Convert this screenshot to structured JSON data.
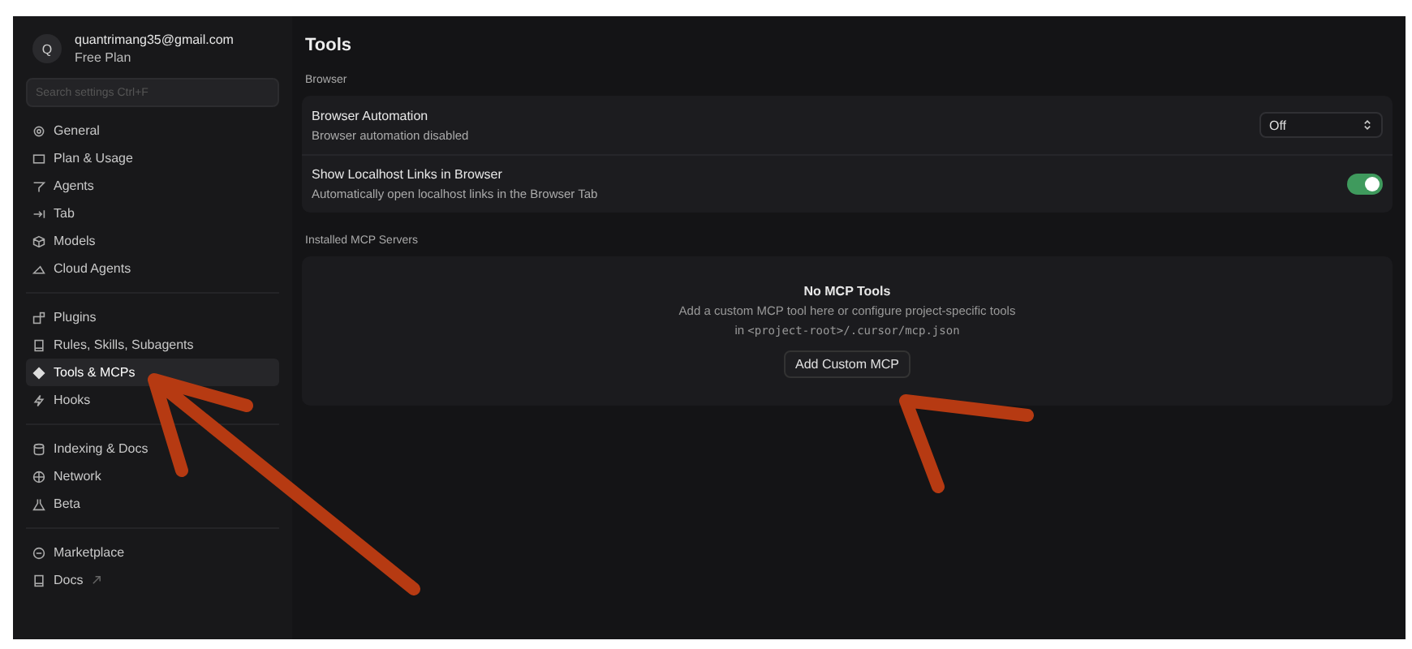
{
  "account": {
    "avatar": "Q",
    "email": "quantrimang35@gmail.com",
    "plan": "Free Plan"
  },
  "search": {
    "placeholder": "Search settings Ctrl+F"
  },
  "sidebar": {
    "groups": [
      {
        "items": [
          {
            "label": "General",
            "selected": false
          },
          {
            "label": "Plan & Usage",
            "selected": false
          },
          {
            "label": "Agents",
            "selected": false
          },
          {
            "label": "Tab",
            "selected": false
          },
          {
            "label": "Models",
            "selected": false
          },
          {
            "label": "Cloud Agents",
            "selected": false
          }
        ]
      },
      {
        "items": [
          {
            "label": "Plugins",
            "selected": false
          },
          {
            "label": "Rules, Skills, Subagents",
            "selected": false
          },
          {
            "label": "Tools & MCPs",
            "selected": true
          },
          {
            "label": "Hooks",
            "selected": false
          }
        ]
      },
      {
        "items": [
          {
            "label": "Indexing & Docs",
            "selected": false
          },
          {
            "label": "Network",
            "selected": false
          },
          {
            "label": "Beta",
            "selected": false
          }
        ]
      },
      {
        "items": [
          {
            "label": "Marketplace",
            "selected": false
          },
          {
            "label": "Docs",
            "selected": false,
            "external": true
          }
        ]
      }
    ]
  },
  "page": {
    "title": "Tools",
    "section": "Browser",
    "settings": [
      {
        "kind": "select",
        "title": "Browser Automation",
        "description": "Browser automation disabled",
        "value": "Off"
      },
      {
        "kind": "toggle",
        "title": "Show Localhost Links in Browser",
        "description": "Automatically open localhost links in the Browser Tab",
        "on": true
      }
    ],
    "mcp_section": "Installed MCP Servers",
    "empty": {
      "title": "No MCP Tools",
      "line1": "Add a custom MCP tool here or configure project-specific tools",
      "line2_prefix": "in",
      "line2_code": "<project-root>/.cursor/mcp.json",
      "button": "Add Custom MCP"
    }
  }
}
